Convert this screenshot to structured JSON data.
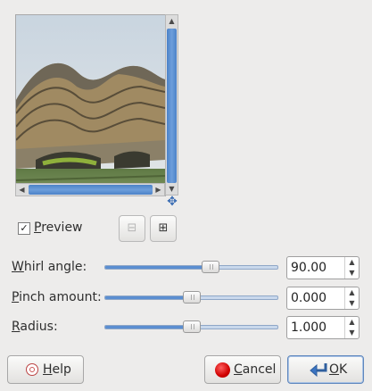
{
  "preview": {
    "checkbox_label_mnemonic": "P",
    "checkbox_label_rest": "review",
    "checked": true,
    "check_glyph": "✓"
  },
  "icons": {
    "navigate": "move-arrows-icon",
    "zoom_out": "zoom-out-icon",
    "zoom_in": "zoom-in-icon",
    "help": "lifebuoy-icon",
    "cancel": "red-circle-icon",
    "ok": "return-arrow-icon"
  },
  "params": [
    {
      "mnemonic": "W",
      "label_rest": "hirl angle:",
      "value": "90.00",
      "level": 0.625
    },
    {
      "mnemonic": "P",
      "label_rest": "inch amount:",
      "value": "0.000",
      "level": 0.5
    },
    {
      "mnemonic": "R",
      "label_rest": "adius:",
      "value": "1.000",
      "level": 0.5
    }
  ],
  "buttons": {
    "help": {
      "mnemonic": "H",
      "rest": "elp"
    },
    "cancel": {
      "mnemonic": "C",
      "rest": "ancel"
    },
    "ok": {
      "mnemonic": "O",
      "rest": "K"
    }
  },
  "colors": {
    "slider_fill": "#5b8ed1",
    "scroll_thumb": "#5b8ed1",
    "cancel_red": "#d00000"
  }
}
